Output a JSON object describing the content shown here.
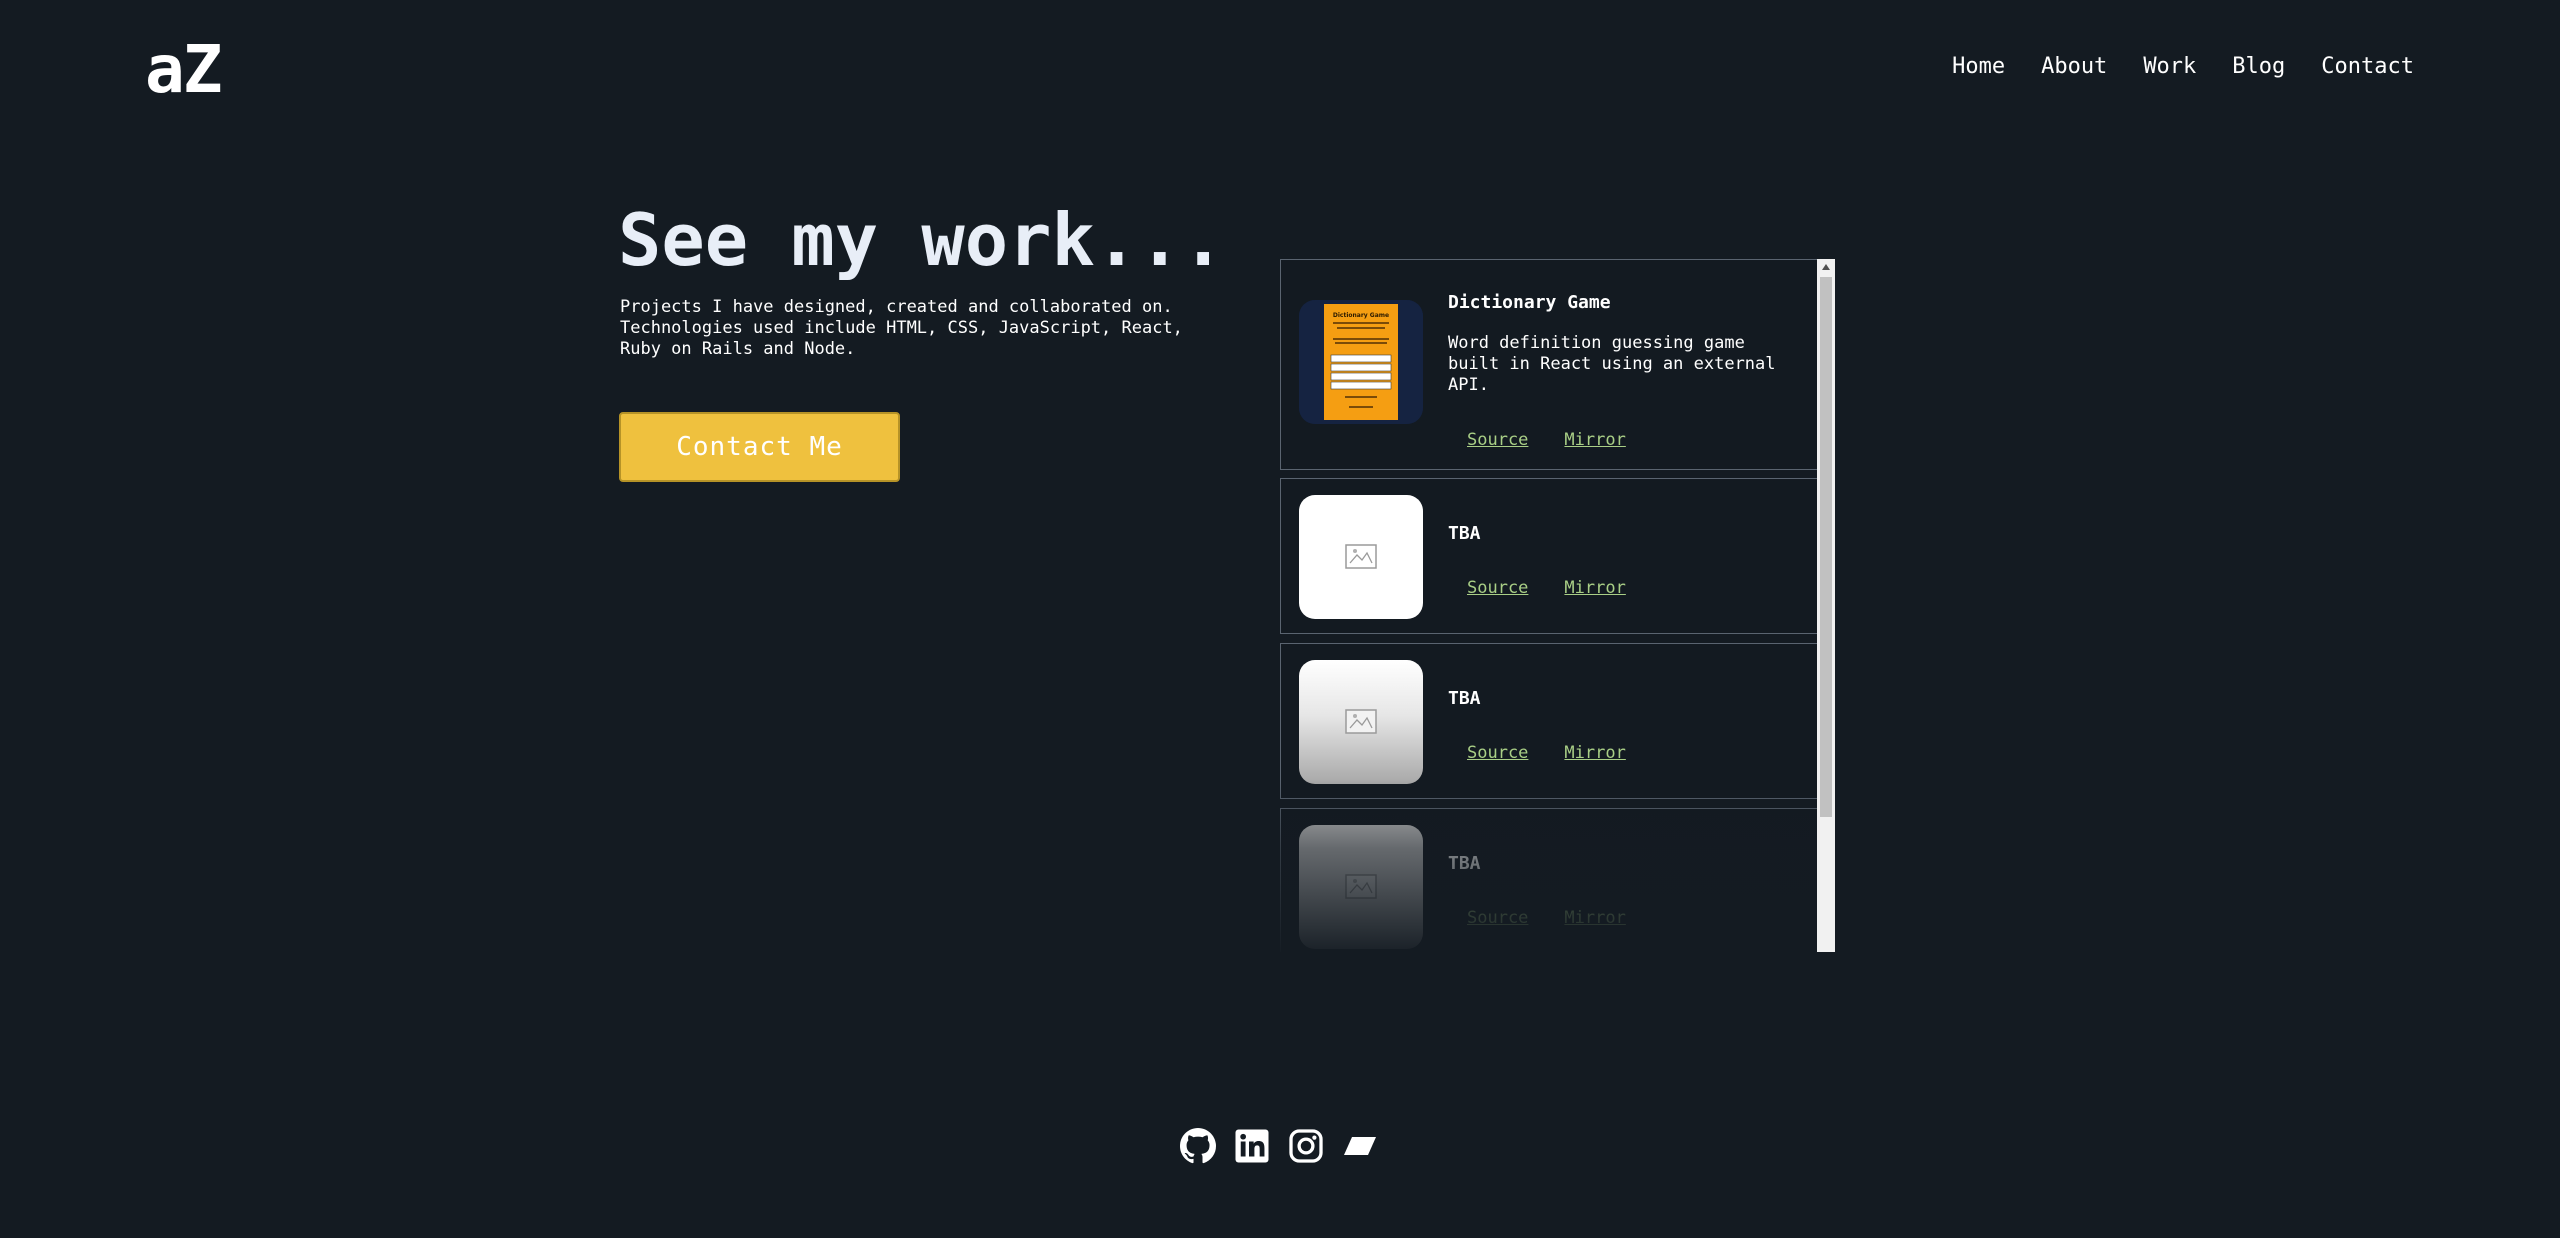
{
  "logo": "aZ",
  "nav": [
    {
      "label": "Home"
    },
    {
      "label": "About"
    },
    {
      "label": "Work"
    },
    {
      "label": "Blog"
    },
    {
      "label": "Contact"
    }
  ],
  "hero": {
    "title": "See my work...",
    "description": "Projects I have designed, created and collaborated on. Technologies used include HTML, CSS, JavaScript, React, Ruby on Rails and Node.",
    "cta_label": "Contact Me"
  },
  "projects": [
    {
      "title": "Dictionary Game",
      "description": "Word definition guessing game built in React using an external API.",
      "source_label": "Source",
      "mirror_label": "Mirror",
      "thumb_icon": "dictionary-game-screenshot",
      "thumb_title": "Dictionary Game"
    },
    {
      "title": "TBA",
      "description": "",
      "source_label": "Source",
      "mirror_label": "Mirror",
      "thumb_icon": "image-placeholder-icon"
    },
    {
      "title": "TBA",
      "description": "",
      "source_label": "Source",
      "mirror_label": "Mirror",
      "thumb_icon": "image-placeholder-icon"
    },
    {
      "title": "TBA",
      "description": "",
      "source_label": "Source",
      "mirror_label": "Mirror",
      "thumb_icon": "image-placeholder-icon"
    }
  ],
  "socials": [
    {
      "icon": "github-icon"
    },
    {
      "icon": "linkedin-icon"
    },
    {
      "icon": "instagram-icon"
    },
    {
      "icon": "parallelogram-logo-icon"
    }
  ],
  "colors": {
    "background": "#141b22",
    "accent": "#efc13e",
    "link": "#a9cf86",
    "card_border": "#5a6470"
  }
}
